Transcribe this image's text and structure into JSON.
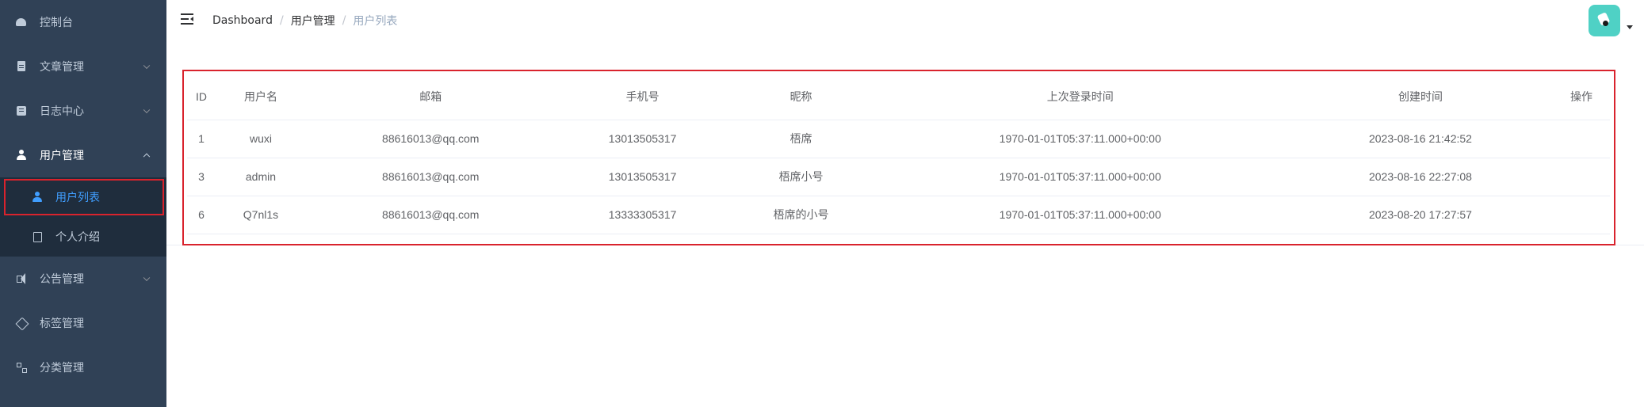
{
  "sidebar": {
    "items": [
      {
        "label": "控制台"
      },
      {
        "label": "文章管理"
      },
      {
        "label": "日志中心"
      },
      {
        "label": "用户管理"
      },
      {
        "label": "公告管理"
      },
      {
        "label": "标签管理"
      },
      {
        "label": "分类管理"
      }
    ],
    "user_submenu": [
      {
        "label": "用户列表"
      },
      {
        "label": "个人介绍"
      }
    ]
  },
  "header": {
    "breadcrumb": [
      "Dashboard",
      "用户管理",
      "用户列表"
    ],
    "separator": "/"
  },
  "table": {
    "columns": [
      "ID",
      "用户名",
      "邮箱",
      "手机号",
      "昵称",
      "上次登录时间",
      "创建时间",
      "操作"
    ],
    "rows": [
      [
        "1",
        "wuxi",
        "88616013@qq.com",
        "13013505317",
        "梧席",
        "1970-01-01T05:37:11.000+00:00",
        "2023-08-16 21:42:52",
        ""
      ],
      [
        "3",
        "admin",
        "88616013@qq.com",
        "13013505317",
        "梧席小号",
        "1970-01-01T05:37:11.000+00:00",
        "2023-08-16 22:27:08",
        ""
      ],
      [
        "6",
        "Q7nl1s",
        "88616013@qq.com",
        "13333305317",
        "梧席的小号",
        "1970-01-01T05:37:11.000+00:00",
        "2023-08-20 17:27:57",
        ""
      ]
    ]
  },
  "colors": {
    "sidebar_bg": "#304156",
    "submenu_bg": "#1f2d3d",
    "active_text": "#409eff",
    "highlight_border": "#d9232d",
    "avatar_bg": "#4fd1c5"
  }
}
